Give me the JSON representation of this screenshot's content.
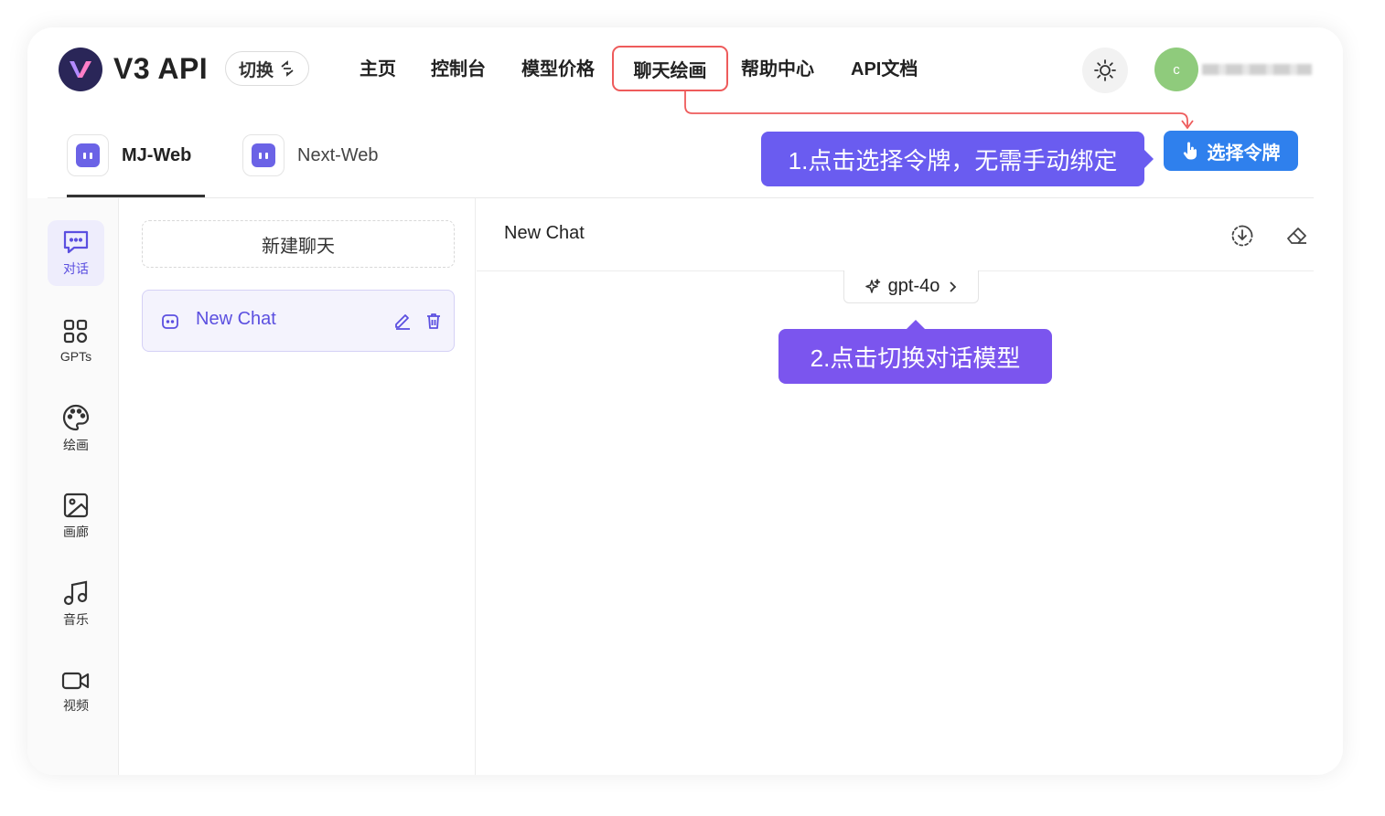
{
  "header": {
    "brand": "V3 API",
    "switch_label": "切换",
    "nav": [
      "主页",
      "控制台",
      "模型价格",
      "聊天绘画",
      "帮助中心",
      "API文档"
    ],
    "avatar_letter": "c"
  },
  "subtabs": [
    "MJ-Web",
    "Next-Web"
  ],
  "annotations": {
    "callout1": "1.点击选择令牌，无需手动绑定",
    "callout2": "2.点击切换对话模型"
  },
  "token_button": "选择令牌",
  "rail": [
    {
      "label": "对话",
      "icon": "chat-icon"
    },
    {
      "label": "GPTs",
      "icon": "apps-icon"
    },
    {
      "label": "绘画",
      "icon": "palette-icon"
    },
    {
      "label": "画廊",
      "icon": "image-icon"
    },
    {
      "label": "音乐",
      "icon": "music-icon"
    },
    {
      "label": "视频",
      "icon": "video-icon"
    }
  ],
  "chat_list": {
    "new_chat_button": "新建聊天",
    "items": [
      {
        "title": "New Chat"
      }
    ]
  },
  "main": {
    "title": "New Chat",
    "model": "gpt-4o"
  },
  "colors": {
    "accent": "#5b4fe0",
    "callout": "#6a5cf0",
    "token_button": "#2f80ed",
    "highlight_border": "#ee5b5b"
  }
}
